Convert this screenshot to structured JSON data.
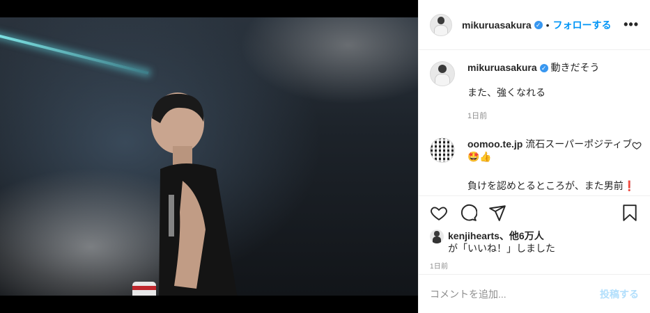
{
  "header": {
    "username": "mikuruasakura",
    "verified_glyph": "✓",
    "separator": "•",
    "follow_label": "フォローする",
    "more_glyph": "•••"
  },
  "caption": {
    "username": "mikuruasakura",
    "text": "動きだそう",
    "extra": "また、強くなれる",
    "time": "1日前"
  },
  "comment": {
    "username": "oomoo.te.jp",
    "text": "流石スーパーポジティブ",
    "emoji": "🤩👍",
    "line2": "負けを認めとるところが、また男前❗"
  },
  "likes": {
    "users": "kenjihearts、他6万人",
    "suffix": "が「いいね！」しました"
  },
  "post_time": "1日前",
  "add_comment": {
    "placeholder": "コメントを追加...",
    "post_label": "投稿する"
  },
  "colors": {
    "accent": "#0095f6",
    "accent_disabled": "#b2dffc",
    "muted": "#8e8e8e"
  },
  "icons": [
    "heart-icon",
    "comment-icon",
    "share-icon",
    "bookmark-icon",
    "more-icon",
    "verified-icon"
  ]
}
